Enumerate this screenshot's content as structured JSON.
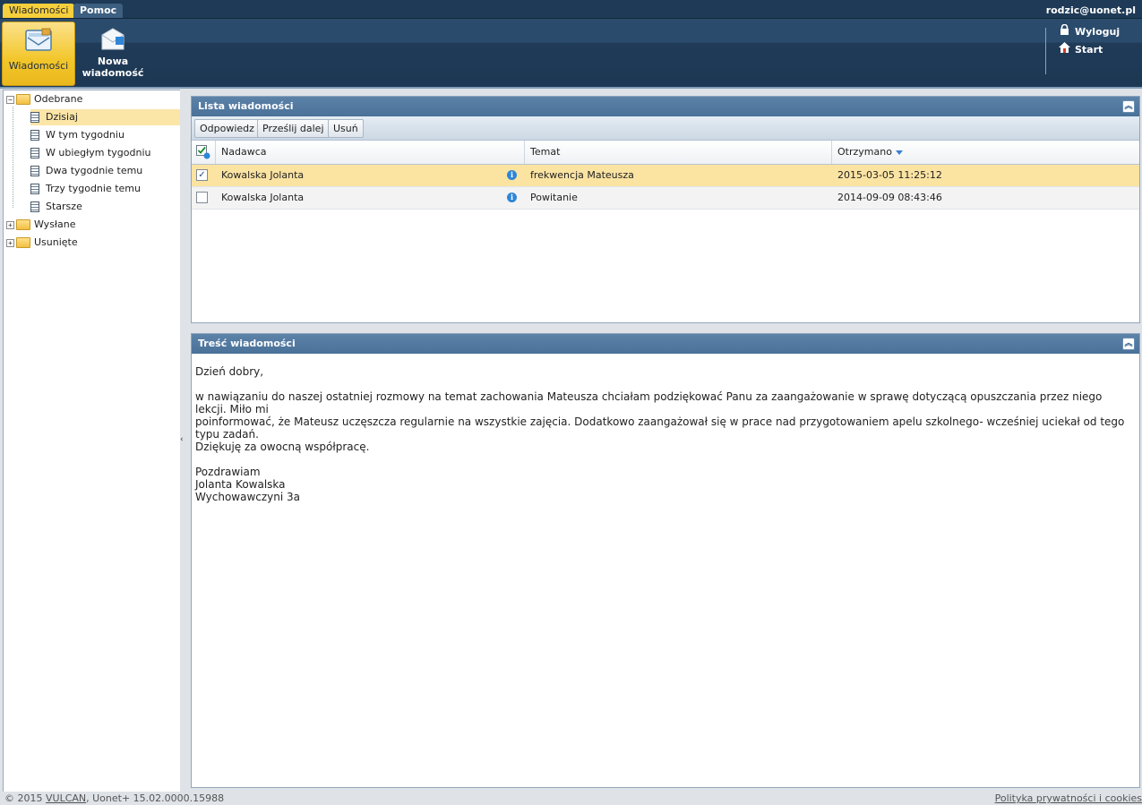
{
  "topbar": {
    "tabs": [
      {
        "label": "Wiadomości"
      },
      {
        "label": "Pomoc"
      }
    ],
    "user_email": "rodzic@uonet.pl"
  },
  "ribbon": {
    "buttons": [
      {
        "label": "Wiadomości",
        "icon": "envelope-icon"
      },
      {
        "label": "Nowa wiadomość",
        "icon": "new-message-icon"
      }
    ],
    "links": [
      {
        "label": "Wyloguj",
        "icon": "lock-icon"
      },
      {
        "label": "Start",
        "icon": "home-icon"
      }
    ]
  },
  "tree": {
    "odebrane": {
      "label": "Odebrane",
      "children": [
        {
          "label": "Dzisiaj",
          "selected": true
        },
        {
          "label": "W tym tygodniu"
        },
        {
          "label": "W ubiegłym tygodniu"
        },
        {
          "label": "Dwa tygodnie temu"
        },
        {
          "label": "Trzy tygodnie temu"
        },
        {
          "label": "Starsze"
        }
      ]
    },
    "wyslane": {
      "label": "Wysłane"
    },
    "usuniete": {
      "label": "Usunięte"
    }
  },
  "list_panel": {
    "title": "Lista wiadomości",
    "toolbar": {
      "reply": "Odpowiedz",
      "forward": "Prześlij dalej",
      "delete": "Usuń"
    },
    "columns": {
      "sender": "Nadawca",
      "subject": "Temat",
      "received": "Otrzymano"
    },
    "rows": [
      {
        "checked": true,
        "sender": "Kowalska Jolanta",
        "subject": "frekwencja Mateusza",
        "received": "2015-03-05 11:25:12"
      },
      {
        "checked": false,
        "sender": "Kowalska Jolanta",
        "subject": "Powitanie",
        "received": "2014-09-09 08:43:46"
      }
    ]
  },
  "content_panel": {
    "title": "Treść wiadomości",
    "greeting": "Dzień dobry,",
    "body_lines": [
      "w nawiązaniu do naszej ostatniej rozmowy na temat zachowania Mateusza chciałam podziękować Panu za zaangażowanie w sprawę dotyczącą opuszczania przez niego lekcji. Miło mi",
      "poinformować, że Mateusz uczęszcza regularnie na wszystkie zajęcia. Dodatkowo zaangażował się w prace nad przygotowaniem apelu szkolnego- wcześniej uciekał od tego typu zadań.",
      "Dziękuję za owocną współpracę."
    ],
    "closing": [
      "Pozdrawiam",
      "Jolanta Kowalska",
      "Wychowawczyni 3a"
    ]
  },
  "footer": {
    "copyright_prefix": "© 2015 ",
    "vulcan_link": "VULCAN",
    "version": ", Uonet+ 15.02.0000.15988",
    "privacy": "Polityka prywatności i cookies"
  },
  "colors": {
    "header_dark": "#1e3a56",
    "active_yellow": "#f2c62a",
    "panel_header": "#4a7198",
    "selection": "#fbe3a2"
  }
}
